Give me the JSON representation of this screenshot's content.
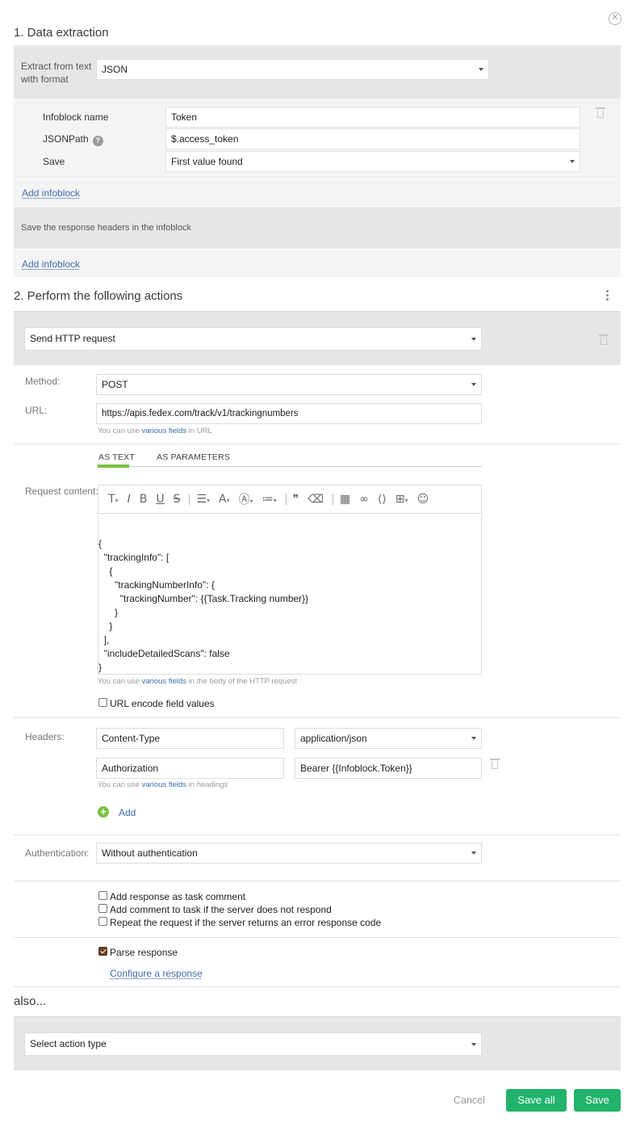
{
  "close_icon": "close-circle-icon",
  "section1": {
    "title": "1. Data extraction",
    "extract_label_line1": "Extract from text",
    "extract_label_line2": "with format",
    "format_value": "JSON",
    "infoblock_name_label": "Infoblock name",
    "infoblock_name_value": "Token",
    "jsonpath_label": "JSONPath",
    "jsonpath_value": "$.access_token",
    "save_label": "Save",
    "save_value": "First value found",
    "add_infoblock": "Add infoblock",
    "save_headers_text": "Save the response headers in the infoblock",
    "add_infoblock_2": "Add infoblock"
  },
  "section2": {
    "title": "2. Perform the following actions",
    "action_type": "Send HTTP request",
    "method_label": "Method:",
    "method_value": "POST",
    "url_label": "URL:",
    "url_value": "https://apis.fedex.com/track/v1/trackingnumbers",
    "url_hint_prefix": "You can use ",
    "url_hint_link": "various fields",
    "url_hint_suffix": " in URL",
    "tab_as_text": "AS TEXT",
    "tab_as_parameters": "AS PARAMETERS",
    "request_content_label": "Request content:",
    "body_lines": [
      "{",
      "  \"trackingInfo\": [",
      "    {",
      "      \"trackingNumberInfo\": {",
      "        \"trackingNumber\": {{Task.Tracking number}}",
      "      }",
      "    }",
      "  ],",
      "  \"includeDetailedScans\": false",
      "}"
    ],
    "body_hint_prefix": "You can use ",
    "body_hint_link": "various fields",
    "body_hint_suffix": " in the body of the HTTP request",
    "url_encode_label": "URL encode field values",
    "headers_label": "Headers:",
    "headers": [
      {
        "name": "Content-Type",
        "value": "application/json"
      },
      {
        "name": "Authorization",
        "value": "Bearer {{Infoblock.Token}}"
      }
    ],
    "headers_hint_prefix": "You can use ",
    "headers_hint_link": "various fields",
    "headers_hint_suffix": " in headings",
    "add_label": "Add",
    "auth_label": "Authentication:",
    "auth_value": "Without authentication",
    "opt_add_comment": "Add response as task comment",
    "opt_no_respond": "Add comment to task if the server does not respond",
    "opt_repeat": "Repeat the request if the server returns an error response code",
    "parse_response": "Parse response",
    "configure_response": "Configure a response"
  },
  "also": {
    "title": "also...",
    "select_placeholder": "Select action type"
  },
  "footer": {
    "cancel": "Cancel",
    "save_all": "Save all",
    "save": "Save"
  },
  "colors": {
    "accent_green": "#21b36b",
    "link_blue": "#3f6ca8",
    "tab_underline": "#7bc143"
  }
}
